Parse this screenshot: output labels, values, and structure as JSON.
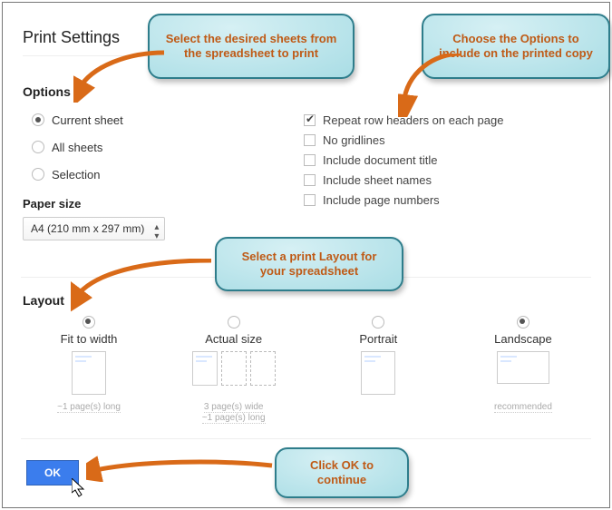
{
  "title": "Print Settings",
  "close_label": "×",
  "sections": {
    "options": "Options",
    "paper_size": "Paper size",
    "layout": "Layout"
  },
  "sheet_options": {
    "current": "Current sheet",
    "all": "All sheets",
    "selection": "Selection"
  },
  "print_options": {
    "repeat_headers": "Repeat row headers on each page",
    "no_gridlines": "No gridlines",
    "include_title": "Include document title",
    "include_sheet_names": "Include sheet names",
    "include_page_numbers": "Include page numbers"
  },
  "paper_size_value": "A4 (210 mm x 297 mm)",
  "layouts": {
    "fit": {
      "name": "Fit to width",
      "sub": "~1 page(s) long"
    },
    "actual": {
      "name": "Actual size",
      "sub1": "3 page(s) wide",
      "sub2": "~1 page(s) long"
    },
    "portrait": {
      "name": "Portrait"
    },
    "landscape": {
      "name": "Landscape",
      "sub": "recommended"
    }
  },
  "ok_label": "OK",
  "callouts": {
    "sheets": "Select the desired sheets from the spreadsheet to print",
    "options": "Choose the Options to include on the printed copy",
    "layout": "Select a print Layout for your spreadsheet",
    "ok": "Click OK to continue"
  }
}
